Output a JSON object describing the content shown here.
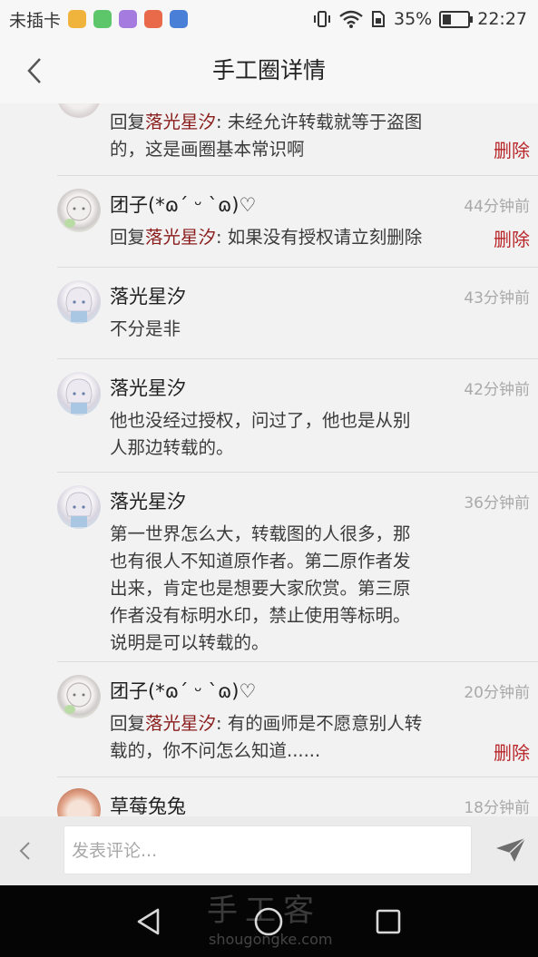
{
  "status_bar": {
    "carrier": "未插卡",
    "battery_percent": "35%",
    "battery_level": 0.35,
    "time": "22:27"
  },
  "header": {
    "title": "手工圈详情"
  },
  "comments": [
    {
      "reply_prefix": "回复",
      "reply_to": "落光星汐",
      "text_line1": ": 未经允许转载就等于盗图",
      "text_line2": "的，这是画圈基本常识啊",
      "delete_label": "删除"
    },
    {
      "name": "团子(*ɷ´ ᵕ `ɷ)♡",
      "time": "44分钟前",
      "reply_prefix": "回复",
      "reply_to": "落光星汐",
      "text": ": 如果没有授权请立刻删除",
      "delete_label": "删除"
    },
    {
      "name": "落光星汐",
      "time": "43分钟前",
      "text": "不分是非"
    },
    {
      "name": "落光星汐",
      "time": "42分钟前",
      "lines": [
        "他也没经过授权，问过了，他也是从别",
        "人那边转载的。"
      ]
    },
    {
      "name": "落光星汐",
      "time": "36分钟前",
      "lines": [
        "第一世界怎么大，转载图的人很多，那",
        "也有很人不知道原作者。第二原作者发",
        "出来，肯定也是想要大家欣赏。第三原",
        "作者没有标明水印，禁止使用等标明。",
        "说明是可以转载的。"
      ]
    },
    {
      "name": "团子(*ɷ´ ᵕ `ɷ)♡",
      "time": "20分钟前",
      "reply_prefix": "回复",
      "reply_to": "落光星汐",
      "text_line1": ": 有的画师是不愿意别人转",
      "text_line2": "载的，你不问怎么知道......",
      "delete_label": "删除"
    },
    {
      "name": "草莓兔兔",
      "time": "18分钟前"
    }
  ],
  "input_bar": {
    "placeholder": "发表评论..."
  },
  "watermark": {
    "line1": "手工客",
    "line2": "shougongke.com"
  }
}
